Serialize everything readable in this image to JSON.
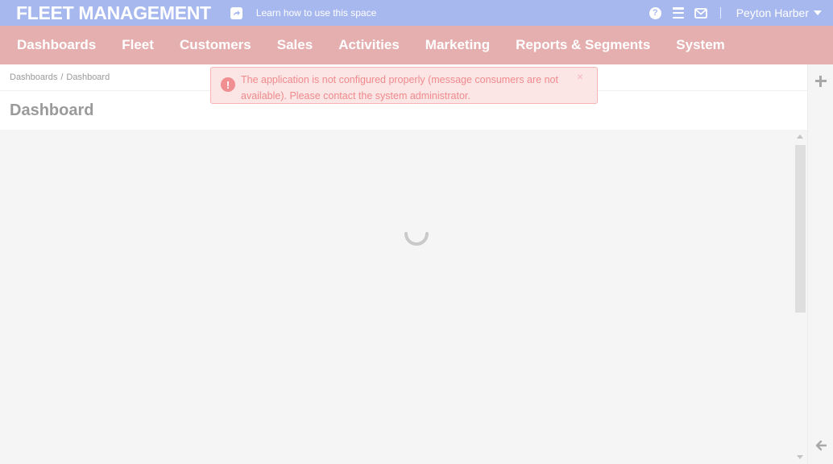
{
  "topbar": {
    "brand": "FLEET MANAGEMENT",
    "share_icon": "share-square-icon",
    "learn_link": "Learn how to use this space",
    "help_icon": "question-circle-icon",
    "help_glyph": "?",
    "menu_icon": "list-icon",
    "mail_icon": "envelope-icon",
    "user_name": "Peyton Harber",
    "caret_icon": "caret-down-icon"
  },
  "nav": {
    "items": [
      {
        "label": "Dashboards"
      },
      {
        "label": "Fleet"
      },
      {
        "label": "Customers"
      },
      {
        "label": "Sales"
      },
      {
        "label": "Activities"
      },
      {
        "label": "Marketing"
      },
      {
        "label": "Reports & Segments"
      },
      {
        "label": "System"
      }
    ]
  },
  "breadcrumb": {
    "items": [
      "Dashboards",
      "Dashboard"
    ],
    "separator": "/"
  },
  "page": {
    "title": "Dashboard"
  },
  "alert": {
    "icon": "exclamation-circle-icon",
    "glyph": "!",
    "message": "The application is not configured properly (message consumers are not available). Please contact the system administrator.",
    "close": "×"
  },
  "right_rail": {
    "add_icon": "plus-icon",
    "collapse_icon": "arrow-left-icon"
  },
  "colors": {
    "topbar_bg": "#a7b8ef",
    "nav_bg": "#e5afb0",
    "alert_bg": "#fce5e5",
    "alert_text": "#ef8a8d",
    "content_bg": "#f5f5f5"
  }
}
